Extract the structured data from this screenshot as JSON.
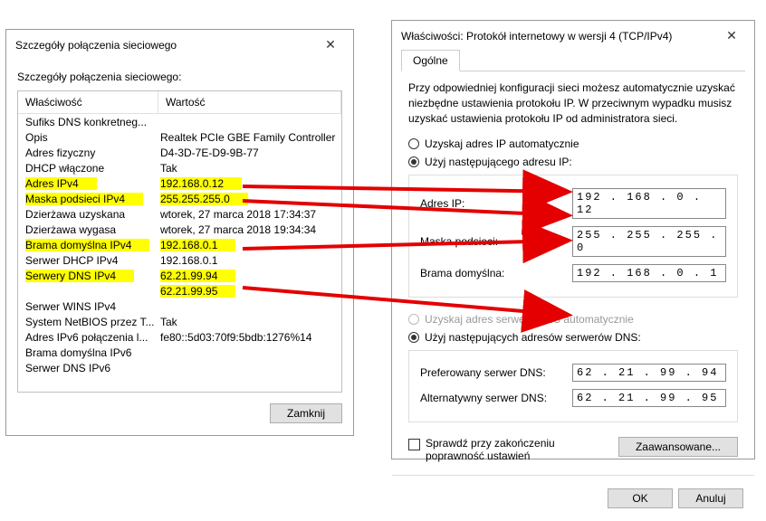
{
  "left": {
    "title": "Szczegóły połączenia sieciowego",
    "label": "Szczegóły połączenia sieciowego:",
    "col_property": "Właściwość",
    "col_value": "Wartość",
    "rows": [
      {
        "p": "Sufiks DNS konkretneg...",
        "v": "",
        "hl": false
      },
      {
        "p": "Opis",
        "v": "Realtek PCIe GBE Family Controller",
        "hl": false
      },
      {
        "p": "Adres fizyczny",
        "v": "D4-3D-7E-D9-9B-77",
        "hl": false
      },
      {
        "p": "DHCP włączone",
        "v": "Tak",
        "hl": false
      },
      {
        "p": "Adres IPv4",
        "v": "192.168.0.12",
        "hl": true
      },
      {
        "p": "Maska podsieci IPv4",
        "v": "255.255.255.0",
        "hl": true
      },
      {
        "p": "Dzierżawa uzyskana",
        "v": "wtorek, 27 marca 2018 17:34:37",
        "hl": false
      },
      {
        "p": "Dzierżawa wygasa",
        "v": "wtorek, 27 marca 2018 19:34:34",
        "hl": false
      },
      {
        "p": "Brama domyślna IPv4",
        "v": "192.168.0.1",
        "hl": true
      },
      {
        "p": "Serwer DHCP IPv4",
        "v": "192.168.0.1",
        "hl": false
      },
      {
        "p": "Serwery DNS IPv4",
        "v": "62.21.99.94",
        "hl": true
      },
      {
        "p": "",
        "v": "62.21.99.95",
        "hl": true
      },
      {
        "p": "Serwer WINS IPv4",
        "v": "",
        "hl": false
      },
      {
        "p": "System NetBIOS przez T...",
        "v": "Tak",
        "hl": false
      },
      {
        "p": "Adres IPv6 połączenia l...",
        "v": "fe80::5d03:70f9:5bdb:1276%14",
        "hl": false
      },
      {
        "p": "Brama domyślna IPv6",
        "v": "",
        "hl": false
      },
      {
        "p": "Serwer DNS IPv6",
        "v": "",
        "hl": false
      }
    ],
    "close_btn": "Zamknij"
  },
  "right": {
    "title": "Właściwości: Protokół internetowy w wersji 4 (TCP/IPv4)",
    "tab_general": "Ogólne",
    "description": "Przy odpowiedniej konfiguracji sieci możesz automatycznie uzyskać niezbędne ustawienia protokołu IP. W przeciwnym wypadku musisz uzyskać ustawienia protokołu IP od administratora sieci.",
    "radio_auto_ip": "Uzyskaj adres IP automatycznie",
    "radio_manual_ip": "Użyj następującego adresu IP:",
    "lbl_ip": "Adres IP:",
    "val_ip": "192 . 168 .  0  .  12",
    "lbl_mask": "Maska podsieci:",
    "val_mask": "255 . 255 . 255 .  0",
    "lbl_gateway": "Brama domyślna:",
    "val_gateway": "192 . 168 .  0  .   1",
    "radio_auto_dns": "Uzyskaj adres serwera DNS automatycznie",
    "radio_manual_dns": "Użyj następujących adresów serwerów DNS:",
    "lbl_dns1": "Preferowany serwer DNS:",
    "val_dns1": "62  .  21 .  99 .  94",
    "lbl_dns2": "Alternatywny serwer DNS:",
    "val_dns2": "62  .  21 .  99 .  95",
    "chk_validate": "Sprawdź przy zakończeniu poprawność ustawień",
    "btn_advanced": "Zaawansowane...",
    "btn_ok": "OK",
    "btn_cancel": "Anuluj"
  }
}
